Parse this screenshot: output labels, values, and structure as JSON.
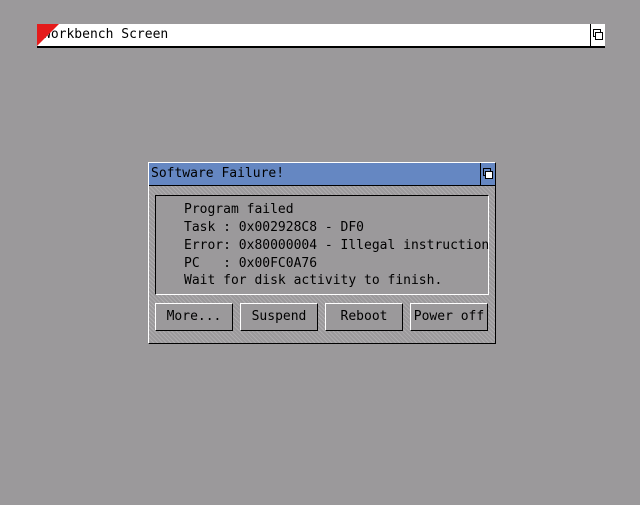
{
  "screen": {
    "title": "Workbench Screen",
    "depth_icon": "depth-arrange-icon",
    "corner_color": "#e51b1b"
  },
  "requester": {
    "title": "Software Failure!",
    "depth_icon": "depth-arrange-icon",
    "titlebar_color": "#6587c2",
    "message_lines": [
      "Program failed",
      "Task : 0x002928C8 - DF0",
      "Error: 0x80000004 - Illegal instruction",
      "PC   : 0x00FC0A76",
      "Wait for disk activity to finish."
    ],
    "buttons": [
      {
        "label": "More..."
      },
      {
        "label": "Suspend"
      },
      {
        "label": "Reboot"
      },
      {
        "label": "Power off"
      }
    ]
  },
  "colors": {
    "desktop": "#9b999b",
    "highlight": "#ffffff",
    "shadow": "#000000"
  }
}
